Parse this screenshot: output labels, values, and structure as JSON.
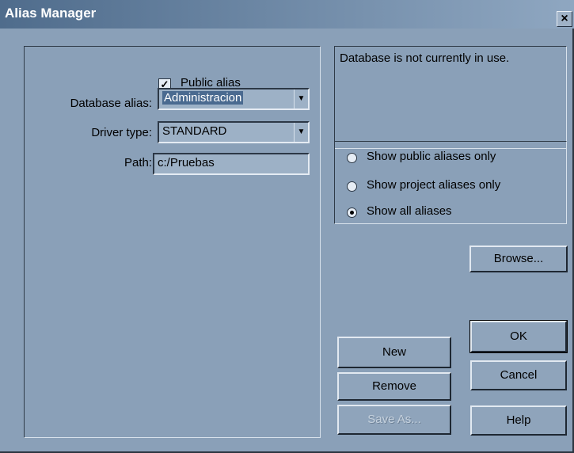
{
  "window": {
    "title": "Alias Manager",
    "close_label": "×"
  },
  "form": {
    "public_alias_label": "Public alias",
    "public_alias_checked": true,
    "database_alias_label": "Database alias:",
    "database_alias_value": "Administracion",
    "driver_type_label": "Driver type:",
    "driver_type_value": "STANDARD",
    "path_label": "Path:",
    "path_value": "c:/Pruebas"
  },
  "status": {
    "message": "Database is not currently in use."
  },
  "filter": {
    "options": [
      "Show public aliases only",
      "Show project aliases only",
      "Show all aliases"
    ],
    "selected": "Show all aliases"
  },
  "buttons": {
    "browse": "Browse...",
    "new": "New",
    "remove": "Remove",
    "save_as": "Save As...",
    "ok": "OK",
    "cancel": "Cancel",
    "help": "Help"
  }
}
